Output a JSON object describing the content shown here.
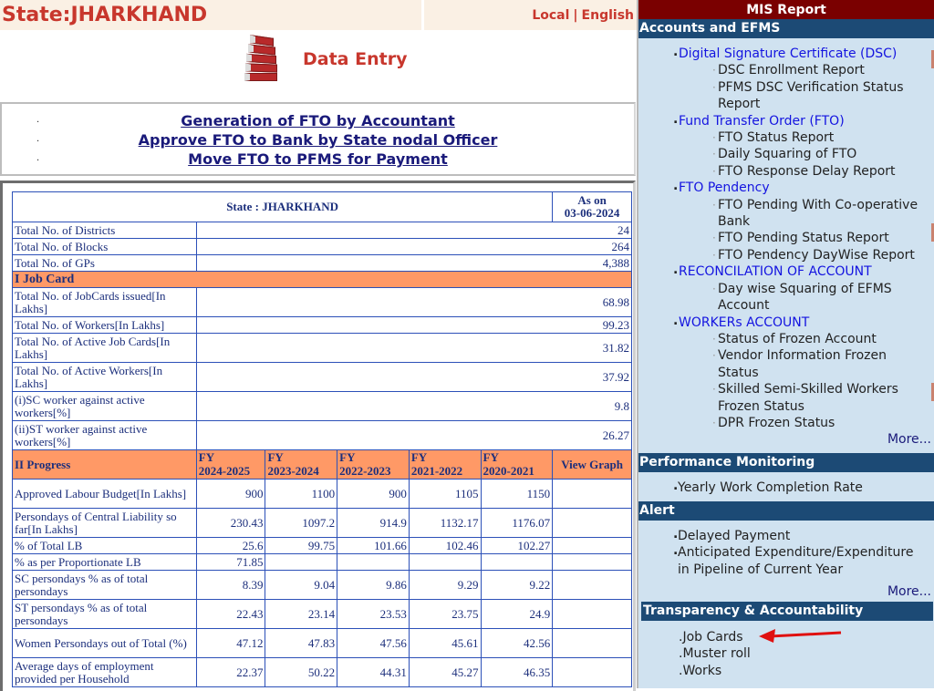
{
  "header": {
    "state_title": "State:JHARKHAND",
    "lang_local": "Local",
    "lang_separator": "|",
    "lang_english": "English"
  },
  "data_entry": {
    "label": "Data Entry",
    "icon": "binders-stack-icon"
  },
  "fto_links": [
    "Generation of FTO by Accountant",
    "Approve FTO to Bank by State nodal Officer",
    "Move FTO to PFMS for Payment"
  ],
  "stats_table": {
    "title": "State : JHARKHAND",
    "as_on_label": "As on",
    "as_on_date": "03-06-2024",
    "summary_rows": [
      {
        "label": "Total No. of Districts",
        "value": "24"
      },
      {
        "label": "Total No. of Blocks",
        "value": "264"
      },
      {
        "label": "Total No. of GPs",
        "value": "4,388"
      }
    ],
    "job_card_section": "I Job Card",
    "job_card_rows": [
      {
        "label": "Total No. of JobCards issued[In Lakhs]",
        "value": "68.98"
      },
      {
        "label": "Total No. of Workers[In Lakhs]",
        "value": "99.23"
      },
      {
        "label": "Total No. of Active Job Cards[In Lakhs]",
        "value": "31.82"
      },
      {
        "label": "Total No. of Active Workers[In Lakhs]",
        "value": "37.92"
      },
      {
        "label": "(i)SC worker against active workers[%]",
        "value": "9.8"
      },
      {
        "label": "(ii)ST worker against active workers[%]",
        "value": "26.27"
      }
    ],
    "progress_section": "II Progress",
    "fy_prefix": "FY",
    "fy_columns": [
      "2024-2025",
      "2023-2024",
      "2022-2023",
      "2021-2022",
      "2020-2021"
    ],
    "view_graph_label": "View Graph",
    "progress_rows": [
      {
        "label": "Approved Labour Budget[In Lakhs]",
        "values": [
          "900",
          "1100",
          "900",
          "1105",
          "1150"
        ]
      },
      {
        "label": "Persondays of Central Liability so far[In Lakhs]",
        "values": [
          "230.43",
          "1097.2",
          "914.9",
          "1132.17",
          "1176.07"
        ]
      },
      {
        "label": "% of Total LB",
        "values": [
          "25.6",
          "99.75",
          "101.66",
          "102.46",
          "102.27"
        ]
      },
      {
        "label": "% as per Proportionate LB",
        "values": [
          "71.85",
          "",
          "",
          "",
          ""
        ]
      },
      {
        "label": "SC persondays % as of total persondays",
        "values": [
          "8.39",
          "9.04",
          "9.86",
          "9.29",
          "9.22"
        ]
      },
      {
        "label": "ST persondays % as of total persondays",
        "values": [
          "22.43",
          "23.14",
          "23.53",
          "23.75",
          "24.9"
        ]
      },
      {
        "label": "Women Persondays out of Total (%)",
        "values": [
          "47.12",
          "47.83",
          "47.56",
          "45.61",
          "42.56"
        ]
      },
      {
        "label": "Average days of employment provided per Household",
        "values": [
          "22.37",
          "50.22",
          "44.31",
          "45.27",
          "46.35"
        ]
      }
    ]
  },
  "sidebar": {
    "title": "MIS Report",
    "accounts": {
      "heading": "Accounts and EFMS",
      "categories": [
        {
          "label": "Digital Signature Certificate (DSC)",
          "items": [
            "DSC Enrollment Report",
            "PFMS DSC Verification Status Report"
          ]
        },
        {
          "label": "Fund Transfer Order (FTO)",
          "items": [
            "FTO Status Report",
            "Daily Squaring of FTO",
            "FTO Response Delay Report"
          ]
        },
        {
          "label": "FTO Pendency",
          "items": [
            "FTO Pending With Co-operative Bank",
            "FTO Pending Status Report",
            "FTO Pendency DayWise Report"
          ]
        },
        {
          "label": "RECONCILATION OF ACCOUNT",
          "items": [
            "Day wise Squaring of EFMS Account"
          ]
        },
        {
          "label": "WORKERs ACCOUNT",
          "items": [
            "Status of Frozen Account",
            "Vendor Information Frozen Status",
            "Skilled Semi-Skilled Workers Frozen Status",
            "DPR Frozen Status"
          ]
        }
      ],
      "more_label": "More..."
    },
    "performance": {
      "heading": "Performance Monitoring",
      "items": [
        "Yearly Work Completion Rate"
      ]
    },
    "alert": {
      "heading": "Alert",
      "items": [
        "Delayed Payment",
        "Anticipated Expenditure/Expenditure in Pipeline of Current Year"
      ],
      "more_label": "More..."
    },
    "transparency": {
      "heading": "Transparency & Accountability",
      "items": [
        ".Job Cards",
        ".Muster roll",
        ".Works"
      ]
    }
  },
  "annotation": {
    "arrow_color": "#e01010",
    "points_to": "Job Cards"
  },
  "colors": {
    "state_red": "#c8372d",
    "mis_header": "#7a0000",
    "section_header": "#1c4a75",
    "sidebar_bg": "#d0e2f0",
    "table_section": "#ff9966",
    "table_border": "#2c50b8"
  }
}
